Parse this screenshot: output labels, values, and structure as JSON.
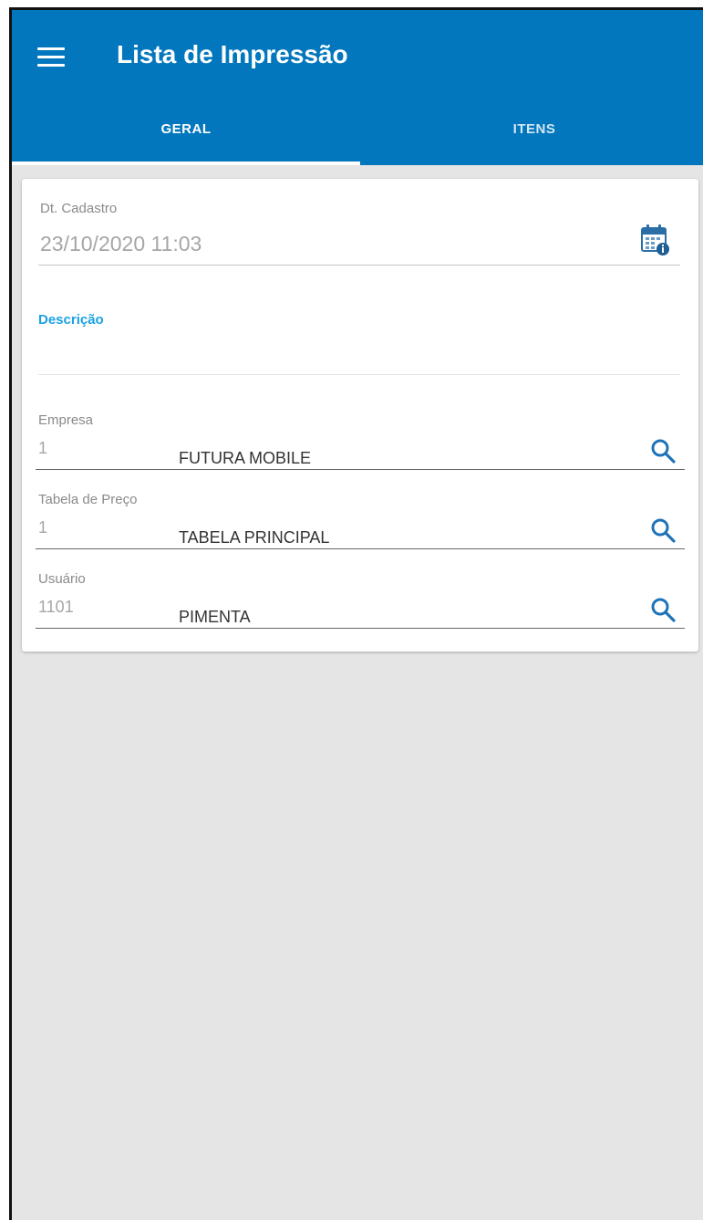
{
  "app": {
    "title": "Lista de Impressão",
    "accent_color": "#0277bd"
  },
  "tabs": [
    {
      "label": "GERAL",
      "active": true
    },
    {
      "label": "ITENS",
      "active": false
    }
  ],
  "form": {
    "dt_cadastro": {
      "label": "Dt. Cadastro",
      "value": "23/10/2020 11:03",
      "icon": "calendar-info-icon"
    },
    "descricao": {
      "label": "Descrição",
      "value": ""
    },
    "empresa": {
      "label": "Empresa",
      "code": "1",
      "name": "FUTURA MOBILE",
      "icon": "search-icon"
    },
    "tabela_preco": {
      "label": "Tabela de Preço",
      "code": "1",
      "name": "TABELA PRINCIPAL",
      "icon": "search-icon"
    },
    "usuario": {
      "label": "Usuário",
      "code": "1101",
      "name": "PIMENTA",
      "icon": "search-icon"
    }
  }
}
